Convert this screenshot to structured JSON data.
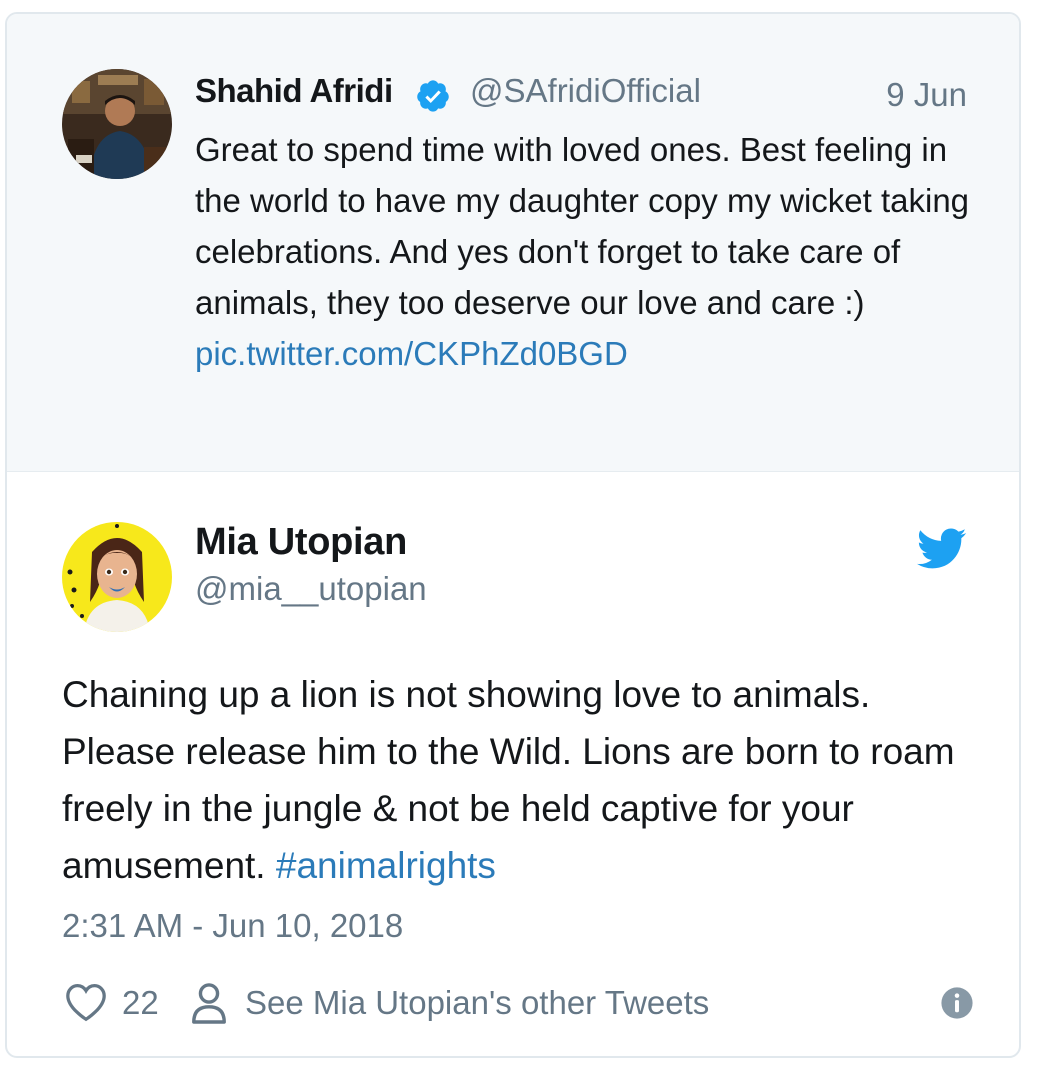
{
  "quoted_tweet": {
    "author_name": "Shahid Afridi",
    "author_handle": "@SAfridiOfficial",
    "date": "9 Jun",
    "text": "Great to spend time with loved ones. Best feeling in the world to have my daughter copy my wicket taking celebrations. And yes don't forget to take care of animals, they too deserve our love and care :)",
    "link": "pic.twitter.com/CKPhZd0BGD",
    "verified_icon": "verified-badge-icon"
  },
  "tweet": {
    "author_name": "Mia Utopian",
    "author_handle": "@mia__utopian",
    "text": "Chaining up a lion is not showing love to animals. Please release him to the Wild. Lions are born to roam freely in the jungle & not be held captive for your amusement.",
    "hashtag": "#animalrights",
    "timestamp": "2:31 AM - Jun 10, 2018",
    "like_count": "22",
    "other_tweets_label": "See Mia Utopian's other Tweets",
    "brand_icon": "twitter-bird-icon"
  },
  "colors": {
    "link": "#2b7bb9",
    "secondary_text": "#657786",
    "twitter_blue": "#1da1f2",
    "quoted_background": "#f5f8fa"
  }
}
